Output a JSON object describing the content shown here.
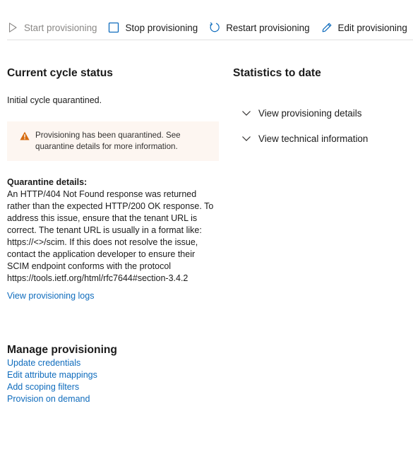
{
  "toolbar": {
    "start_label": "Start provisioning",
    "stop_label": "Stop provisioning",
    "restart_label": "Restart provisioning",
    "edit_label": "Edit provisioning"
  },
  "current_cycle": {
    "heading": "Current cycle status",
    "status_text": "Initial cycle quarantined.",
    "warning": "Provisioning has been quarantined. See quarantine details for more information.",
    "quarantine_title": "Quarantine details:",
    "quarantine_body": "An HTTP/404 Not Found response was returned rather than the expected HTTP/200 OK response. To address this issue, ensure that the tenant URL is correct. The tenant URL is usually in a format like: https://<>/scim. If this does not resolve the issue, contact the application developer to ensure their SCIM endpoint conforms with the protocol https://tools.ietf.org/html/rfc7644#section-3.4.2",
    "logs_link": "View provisioning logs"
  },
  "statistics": {
    "heading": "Statistics to date",
    "details_label": "View provisioning details",
    "technical_label": "View technical information"
  },
  "manage": {
    "heading": "Manage provisioning",
    "links": [
      "Update credentials",
      "Edit attribute mappings",
      "Add scoping filters",
      "Provision on demand"
    ]
  },
  "icons": {
    "start": "play-icon",
    "stop": "stop-icon",
    "restart": "restart-icon",
    "edit": "pencil-icon",
    "warning": "warning-icon",
    "expand": "chevron-down-icon"
  },
  "colors": {
    "accent": "#0f6cbd",
    "warning_bg": "#fdf6f1",
    "warning_icon": "#d66b0f",
    "disabled": "#8a8886"
  }
}
